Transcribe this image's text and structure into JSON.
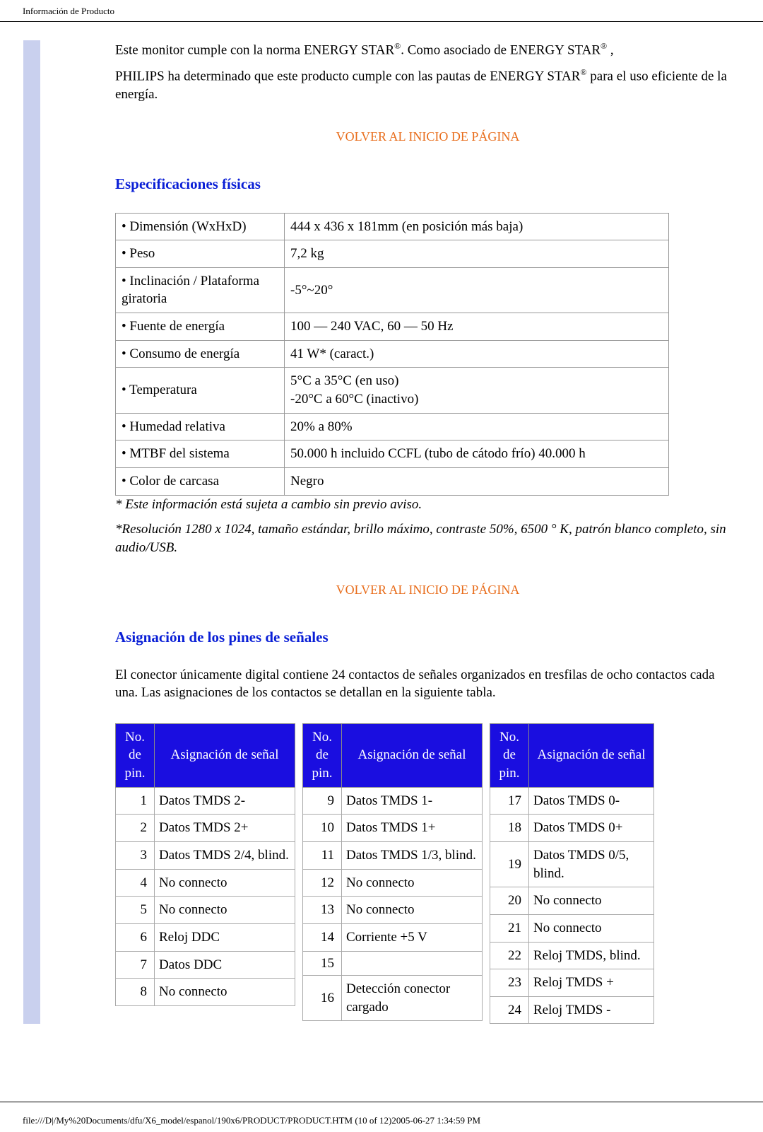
{
  "page": {
    "header_title": "Información de Producto",
    "footer": "file:///D|/My%20Documents/dfu/X6_model/espanol/190x6/PRODUCT/PRODUCT.HTM (10 of 12)2005-06-27 1:34:59 PM"
  },
  "intro": {
    "p1_a": "Este monitor cumple con la norma ENERGY STAR",
    "p1_b": ". Como asociado de ENERGY STAR",
    "p1_c": " ,",
    "p2_a": "PHILIPS ha determinado que este producto cumple con las pautas de ENERGY STAR",
    "p2_b": " para el uso eficiente de la energía.",
    "reg": "®"
  },
  "links": {
    "back_top": "VOLVER AL INICIO DE PÁGINA"
  },
  "phys": {
    "title": "Especificaciones físicas",
    "rows": [
      {
        "label": "• Dimensión (WxHxD)",
        "value": "444 x 436 x 181mm (en posición más baja)"
      },
      {
        "label": "• Peso",
        "value": "7,2 kg"
      },
      {
        "label": "• Inclinación / Plataforma giratoria",
        "value": "-5°~20°"
      },
      {
        "label": "• Fuente de energía",
        "value": "100 — 240 VAC, 60 — 50 Hz"
      },
      {
        "label": "• Consumo de energía",
        "value": "41 W* (caract.)"
      },
      {
        "label": "• Temperatura",
        "value": "5°C a 35°C (en uso)\n-20°C a 60°C (inactivo)"
      },
      {
        "label": "• Humedad relativa",
        "value": "20% a 80%"
      },
      {
        "label": "• MTBF del sistema",
        "value": "50.000 h incluido CCFL (tubo de cátodo frío) 40.000 h"
      },
      {
        "label": "• Color de carcasa",
        "value": "Negro"
      }
    ],
    "note1": "* Este información está sujeta a cambio sin previo aviso.",
    "note2": "*Resolución 1280 x 1024, tamaño estándar, brillo máximo, contraste 50%, 6500 ° K, patrón blanco completo, sin audio/USB."
  },
  "pins": {
    "title": "Asignación de los pines de señales",
    "intro": "El conector únicamente digital contiene 24 contactos de señales organizados en tresfilas de ocho contactos cada una. Las asignaciones de los contactos se detallan en la siguiente tabla.",
    "head_pin": "No. de pin.",
    "head_sig": "Asignación de señal",
    "groups": [
      {
        "rows": [
          {
            "n": "1",
            "s": "Datos TMDS 2-"
          },
          {
            "n": "2",
            "s": "Datos TMDS 2+"
          },
          {
            "n": "3",
            "s": "Datos TMDS 2/4, blind."
          },
          {
            "n": "4",
            "s": "No connecto"
          },
          {
            "n": "5",
            "s": "No connecto"
          },
          {
            "n": "6",
            "s": "Reloj DDC"
          },
          {
            "n": "7",
            "s": "Datos DDC"
          },
          {
            "n": "8",
            "s": "No connecto"
          }
        ],
        "sigw": "186px"
      },
      {
        "rows": [
          {
            "n": "9",
            "s": "Datos TMDS 1-"
          },
          {
            "n": "10",
            "s": "Datos TMDS 1+"
          },
          {
            "n": "11",
            "s": "Datos TMDS 1/3, blind."
          },
          {
            "n": "12",
            "s": "No connecto"
          },
          {
            "n": "13",
            "s": "No connecto"
          },
          {
            "n": "14",
            "s": "Corriente +5 V"
          },
          {
            "n": "15",
            "s": ""
          },
          {
            "n": "16",
            "s": "Detección conector cargado"
          }
        ],
        "sigw": "186px"
      },
      {
        "rows": [
          {
            "n": "17",
            "s": "Datos TMDS 0-"
          },
          {
            "n": "18",
            "s": "Datos TMDS 0+"
          },
          {
            "n": "19",
            "s": "Datos TMDS 0/5, blind."
          },
          {
            "n": "20",
            "s": "No connecto"
          },
          {
            "n": "21",
            "s": "No connecto"
          },
          {
            "n": "22",
            "s": "Reloj TMDS, blind."
          },
          {
            "n": "23",
            "s": "Reloj TMDS +"
          },
          {
            "n": "24",
            "s": "Reloj TMDS -"
          }
        ],
        "sigw": "164px"
      }
    ]
  }
}
